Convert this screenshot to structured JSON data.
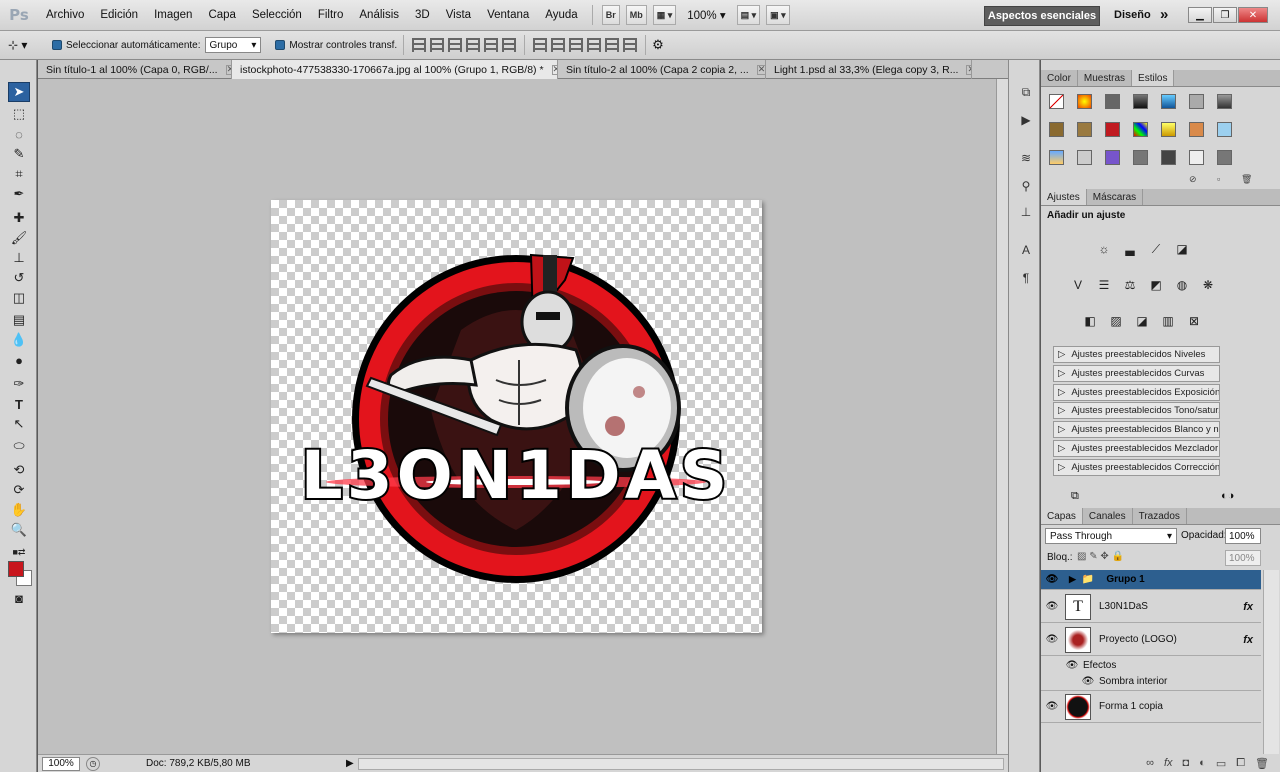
{
  "app": {
    "logo": "Ps"
  },
  "menu": [
    "Archivo",
    "Edición",
    "Imagen",
    "Capa",
    "Selección",
    "Filtro",
    "Análisis",
    "3D",
    "Vista",
    "Ventana",
    "Ayuda"
  ],
  "menubar_icons": {
    "bridge": "Br",
    "minibridge": "Mb",
    "zoom": "100%"
  },
  "workspace": {
    "active": "Aspectos esenciales",
    "other": "Diseño",
    "more": "»"
  },
  "options": {
    "auto_select_label": "Seleccionar automáticamente:",
    "auto_select_value": "Grupo",
    "transform_label": "Mostrar controles transf."
  },
  "tabs": [
    {
      "label": "Sin título-1 al 100% (Capa 0, RGB/...",
      "active": false
    },
    {
      "label": "istockphoto-477538330-170667a.jpg al 100% (Grupo 1, RGB/8) *",
      "active": true
    },
    {
      "label": "Sin título-2 al 100% (Capa 2 copia 2, ...",
      "active": false
    },
    {
      "label": "Light 1.psd al 33,3% (Elega copy 3, R...",
      "active": false
    }
  ],
  "artwork": {
    "logo_text": "L3ON1DAS"
  },
  "status": {
    "zoom": "100%",
    "doc": "Doc: 789,2 KB/5,80 MB"
  },
  "color_panel": {
    "tabs": [
      "Color",
      "Muestras",
      "Estilos"
    ],
    "active": "Estilos"
  },
  "adjust_panel": {
    "tabs": [
      "Ajustes",
      "Máscaras"
    ],
    "title": "Añadir un ajuste",
    "presets": [
      "Ajustes preestablecidos Niveles",
      "Ajustes preestablecidos Curvas",
      "Ajustes preestablecidos Exposición",
      "Ajustes preestablecidos Tono/satur...",
      "Ajustes preestablecidos Blanco y ne...",
      "Ajustes preestablecidos Mezclador ...",
      "Ajustes preestablecidos Corrección ..."
    ]
  },
  "layers_panel": {
    "tabs": [
      "Capas",
      "Canales",
      "Trazados"
    ],
    "blend_mode": "Pass Through",
    "opacity_label": "Opacidad:",
    "opacity": "100%",
    "lock_label": "Bloq.:",
    "fill": "100%",
    "layers": [
      {
        "name": "Grupo 1",
        "type": "group",
        "selected": true
      },
      {
        "name": "L30N1DaS",
        "type": "text",
        "fx": "fx"
      },
      {
        "name": "Proyecto (LOGO)",
        "type": "image",
        "fx": "fx"
      },
      {
        "name": "Efectos",
        "type": "effects"
      },
      {
        "name": "Sombra interior",
        "type": "effect"
      },
      {
        "name": "Forma 1 copia",
        "type": "shape"
      }
    ]
  },
  "colors": {
    "accent": "#2c62a0",
    "foreground": "#c8161d",
    "logo_red": "#e3141c"
  }
}
